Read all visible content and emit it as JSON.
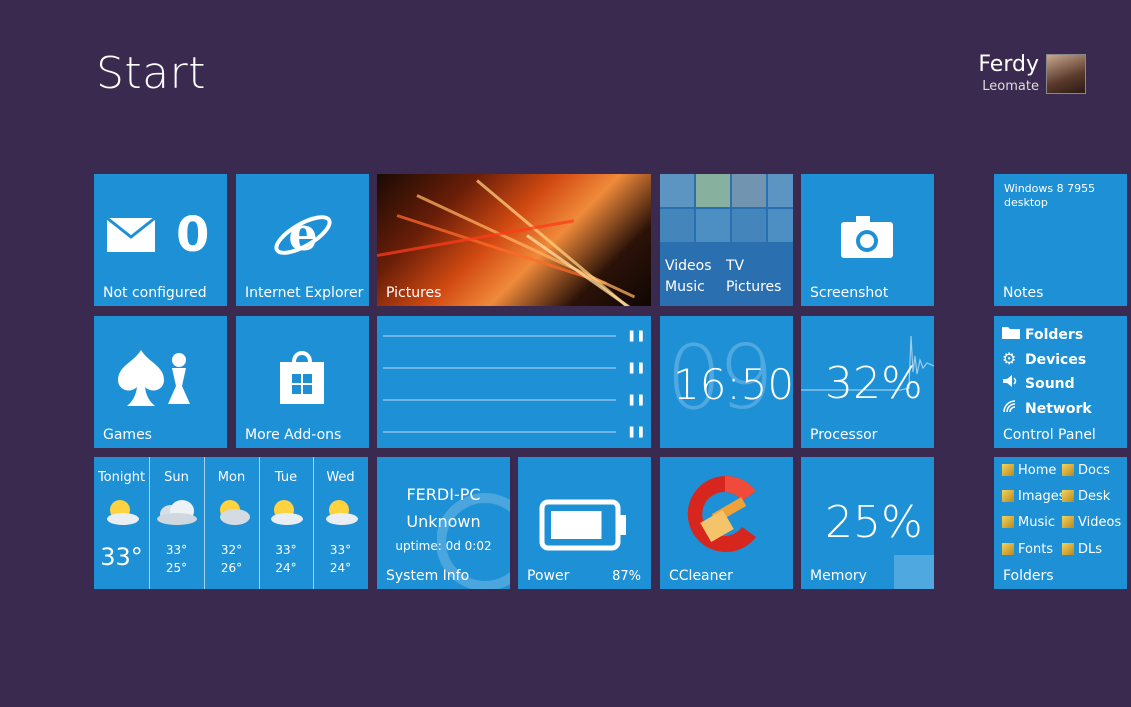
{
  "screen": {
    "title": "Start"
  },
  "user": {
    "first_name": "Ferdy",
    "last_name": "Leomate"
  },
  "tiles": {
    "mail": {
      "count": "0",
      "label": "Not configured"
    },
    "ie": {
      "label": "Internet Explorer"
    },
    "pictures": {
      "label": "Pictures"
    },
    "media": {
      "links": [
        "Videos",
        "TV",
        "Music",
        "Pictures"
      ]
    },
    "screenshot": {
      "label": "Screenshot"
    },
    "notes": {
      "text": "Windows 8 7955 desktop",
      "label": "Notes"
    },
    "games": {
      "label": "Games"
    },
    "addons": {
      "label": "More Add-ons"
    },
    "clock": {
      "time": "16:50",
      "background_digits": "09"
    },
    "processor": {
      "value": "32%",
      "label": "Processor"
    },
    "control_panel": {
      "items": [
        "Folders",
        "Devices",
        "Sound",
        "Network"
      ],
      "label": "Control Panel"
    },
    "weather": {
      "days": [
        {
          "day": "Tonight",
          "temp": "33°",
          "low": ""
        },
        {
          "day": "Sun",
          "temp": "33°",
          "low": "25°"
        },
        {
          "day": "Mon",
          "temp": "32°",
          "low": "26°"
        },
        {
          "day": "Tue",
          "temp": "33°",
          "low": "24°"
        },
        {
          "day": "Wed",
          "temp": "33°",
          "low": "24°"
        }
      ]
    },
    "sysinfo": {
      "pc_name": "FERDI-PC",
      "status": "Unknown",
      "uptime": "uptime: 0d 0:02",
      "label": "System Info"
    },
    "power": {
      "label": "Power",
      "percent": "87%",
      "level": 0.87
    },
    "ccleaner": {
      "label": "CCleaner"
    },
    "memory": {
      "value": "25%",
      "label": "Memory"
    },
    "folders": {
      "items": [
        "Home",
        "Docs",
        "Images",
        "Desk",
        "Music",
        "Videos",
        "Fonts",
        "DLs"
      ],
      "label": "Folders"
    }
  },
  "colors": {
    "background": "#3a2a4f",
    "tile": "#1e90d6"
  }
}
